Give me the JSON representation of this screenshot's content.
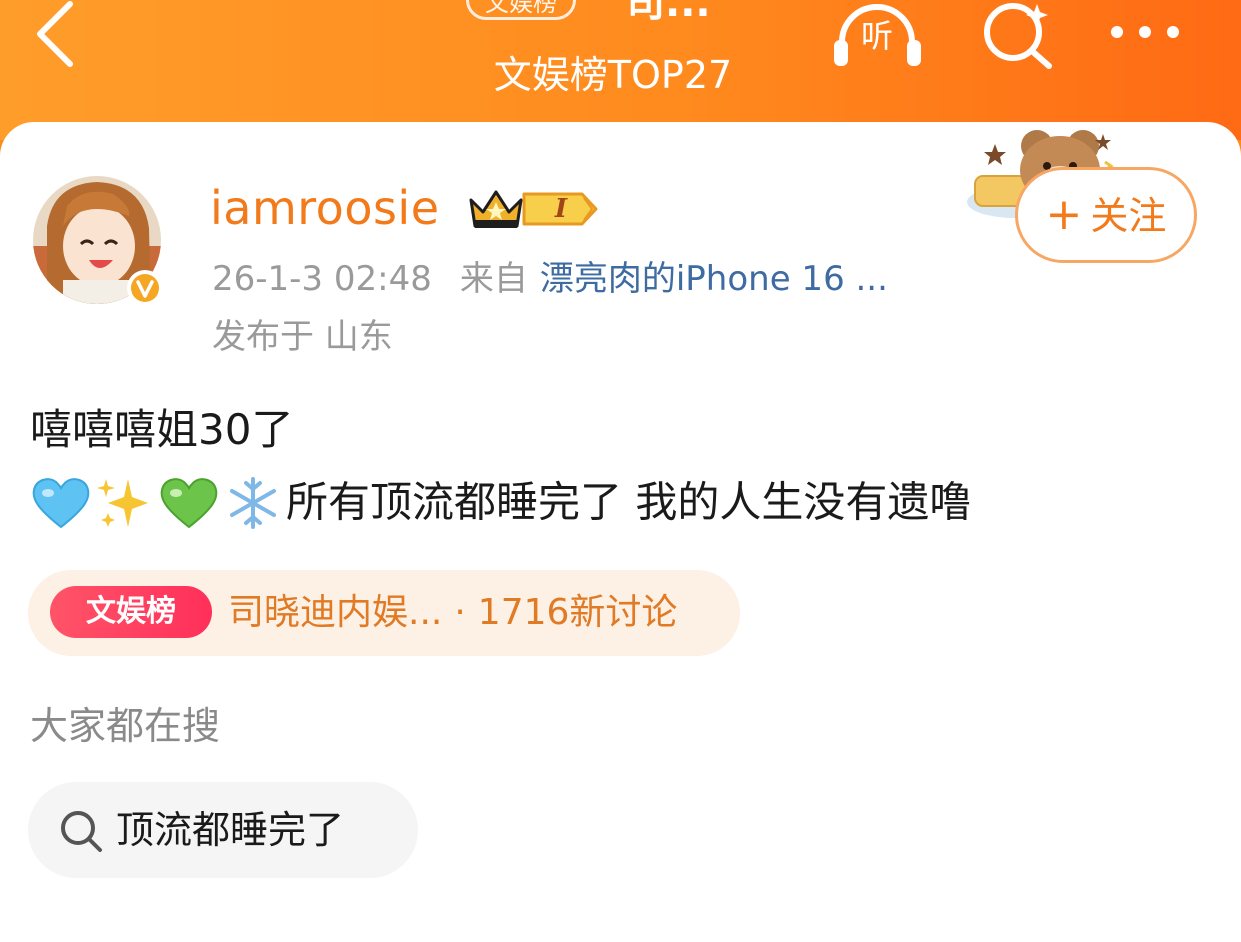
{
  "header": {
    "badge": "文娱榜",
    "title": "司...",
    "subtitle": "文娱榜TOP27",
    "listen_label": "听"
  },
  "post": {
    "username": "iamroosie",
    "level": "I",
    "time": "26-1-3 02:48",
    "from_label": "来自",
    "device": "漂亮肉的iPhone 16 ...",
    "location": "发布于 山东",
    "follow_label": "关注",
    "line1": "嘻嘻嘻姐30了",
    "line2_text": "所有顶流都睡完了 我的人生没有遗噜",
    "emojis": [
      "blue-heart",
      "sparkles",
      "green-heart",
      "snowflake"
    ]
  },
  "hot": {
    "tag": "文娱榜",
    "topic": "司晓迪内娱...",
    "separator": "·",
    "discussion": "1716新讨论"
  },
  "related": {
    "title": "大家都在搜",
    "chip": "顶流都睡完了"
  },
  "colors": {
    "header_orange": "#ff8a1e",
    "username": "#f27a1a",
    "device_link": "#3e6ba2",
    "hot_tag": "#ff2f5a"
  }
}
